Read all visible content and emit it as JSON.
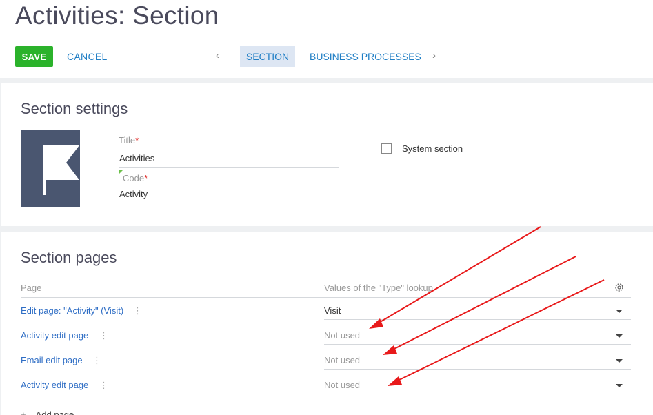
{
  "header": {
    "title": "Activities: Section",
    "save_label": "SAVE",
    "cancel_label": "CANCEL",
    "prev_symbol": "‹",
    "next_symbol": "›",
    "tabs": [
      {
        "label": "SECTION",
        "active": true
      },
      {
        "label": "BUSINESS PROCESSES",
        "active": false
      }
    ]
  },
  "settings": {
    "heading": "Section settings",
    "icon": "flag-icon",
    "title_label": "Title",
    "title_value": "Activities",
    "code_label": "Code",
    "code_value": "Activity",
    "required_mark": "*",
    "system_section_label": "System section",
    "system_section_checked": false
  },
  "pages": {
    "heading": "Section pages",
    "col_page": "Page",
    "col_type": "Values of the \"Type\" lookup",
    "dots": "⋮",
    "rows": [
      {
        "page": "Edit page: \"Activity\" (Visit)",
        "type": "Visit"
      },
      {
        "page": "Activity edit page",
        "type": "Not used"
      },
      {
        "page": "Email edit page",
        "type": "Not used"
      },
      {
        "page": "Activity edit page",
        "type": "Not used"
      }
    ],
    "add_plus": "+",
    "add_label": "Add page"
  },
  "colors": {
    "accent": "#1f7ec5",
    "save": "#2bb22b",
    "icon_bg": "#4a5670",
    "annotation_arrow": "#e8191a"
  }
}
